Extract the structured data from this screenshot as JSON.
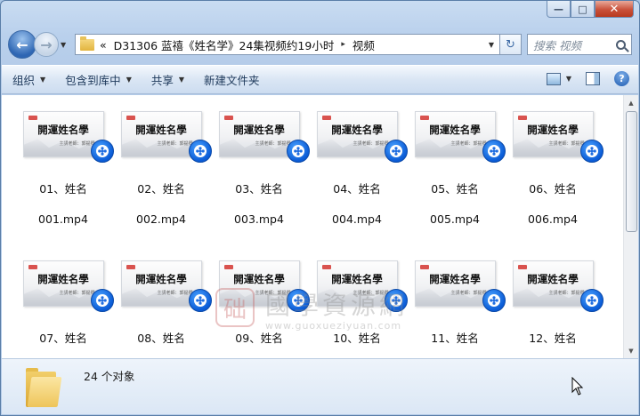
{
  "window": {
    "controls": {
      "minimize": "—",
      "maximize": "□",
      "close": "✕"
    }
  },
  "address_bar": {
    "overflow": "«",
    "segments": [
      "D31306 蓝禧《姓名学》24集视频约19小时",
      "视频"
    ],
    "separator": "▸"
  },
  "search": {
    "placeholder": "搜索 视频"
  },
  "toolbar": {
    "organize": "组织",
    "include_in_library": "包含到库中",
    "share": "共享",
    "new_folder": "新建文件夹",
    "help": "?"
  },
  "thumbnail": {
    "title": "開運姓名學",
    "subtitle": "主講老師：郭提卿"
  },
  "files": [
    {
      "line1": "01、姓名",
      "line2": "001.mp4"
    },
    {
      "line1": "02、姓名",
      "line2": "002.mp4"
    },
    {
      "line1": "03、姓名",
      "line2": "003.mp4"
    },
    {
      "line1": "04、姓名",
      "line2": "004.mp4"
    },
    {
      "line1": "05、姓名",
      "line2": "005.mp4"
    },
    {
      "line1": "06、姓名",
      "line2": "006.mp4"
    },
    {
      "line1": "07、姓名",
      "line2": "007.mp4"
    },
    {
      "line1": "08、姓名",
      "line2": "008.mp4"
    },
    {
      "line1": "09、姓名",
      "line2": "009.mp4"
    },
    {
      "line1": "10、姓名",
      "line2": "010.mp4"
    },
    {
      "line1": "11、姓名",
      "line2": "011.mp4"
    },
    {
      "line1": "12、姓名",
      "line2": "012.mp4"
    }
  ],
  "watermark": {
    "seal": "础",
    "text": "國學資源網",
    "url": "www.guoxueziyuan.com"
  },
  "details": {
    "count": "24 个对象"
  },
  "icons": {
    "back": "back-arrow-icon",
    "forward": "forward-arrow-icon",
    "refresh": "refresh-icon",
    "search": "search-icon",
    "view": "view-options-icon",
    "preview_pane": "preview-pane-icon",
    "help": "help-icon",
    "video_badge": "video-reel-icon"
  }
}
